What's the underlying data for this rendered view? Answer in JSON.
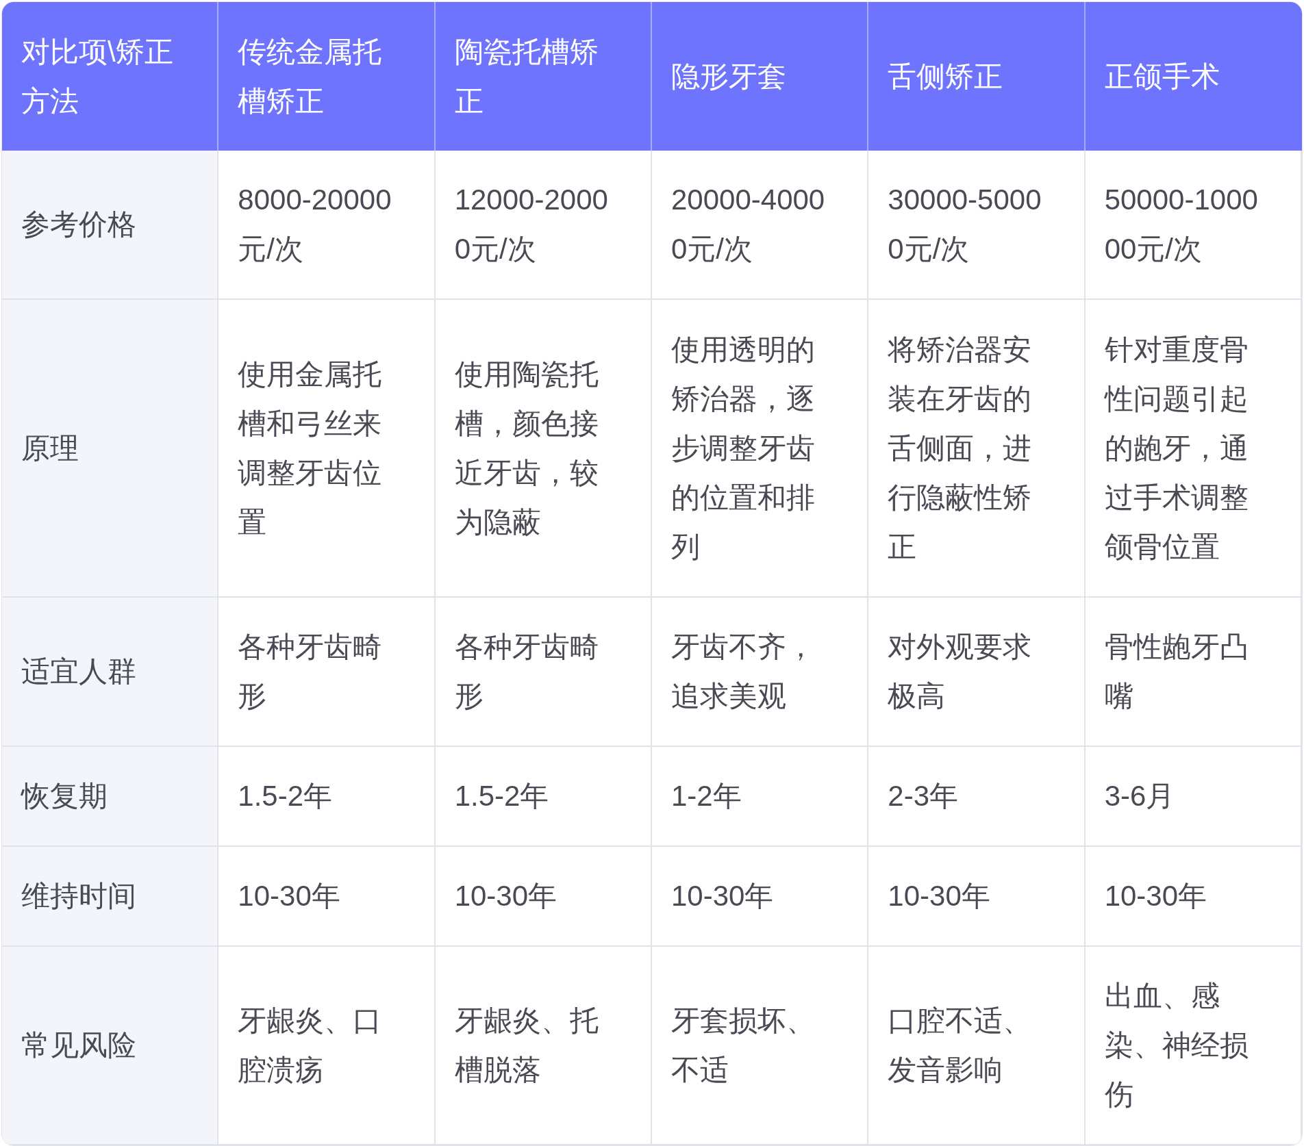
{
  "table": {
    "corner": "对比项\\矫正方法",
    "columns": [
      "传统金属托槽矫正",
      "陶瓷托槽矫正",
      "隐形牙套",
      "舌侧矫正",
      "正颌手术"
    ],
    "rows": [
      {
        "label": "参考价格",
        "cells": [
          "8000-20000元/次",
          "12000-20000元/次",
          "20000-40000元/次",
          "30000-50000元/次",
          "50000-100000元/次"
        ]
      },
      {
        "label": "原理",
        "cells": [
          "使用金属托槽和弓丝来调整牙齿位置",
          "使用陶瓷托槽，颜色接近牙齿，较为隐蔽",
          "使用透明的矫治器，逐步调整牙齿的位置和排列",
          "将矫治器安装在牙齿的舌侧面，进行隐蔽性矫正",
          "针对重度骨性问题引起的龅牙，通过手术调整颌骨位置"
        ]
      },
      {
        "label": "适宜人群",
        "cells": [
          "各种牙齿畸形",
          "各种牙齿畸形",
          "牙齿不齐，追求美观",
          "对外观要求极高",
          "骨性龅牙凸嘴"
        ]
      },
      {
        "label": "恢复期",
        "cells": [
          "1.5-2年",
          "1.5-2年",
          "1-2年",
          "2-3年",
          "3-6月"
        ]
      },
      {
        "label": "维持时间",
        "cells": [
          "10-30年",
          "10-30年",
          "10-30年",
          "10-30年",
          "10-30年"
        ]
      },
      {
        "label": "常见风险",
        "cells": [
          "牙龈炎、口腔溃疡",
          "牙龈炎、托槽脱落",
          "牙套损坏、不适",
          "口腔不适、发音影响",
          "出血、感染、神经损伤"
        ]
      }
    ]
  }
}
